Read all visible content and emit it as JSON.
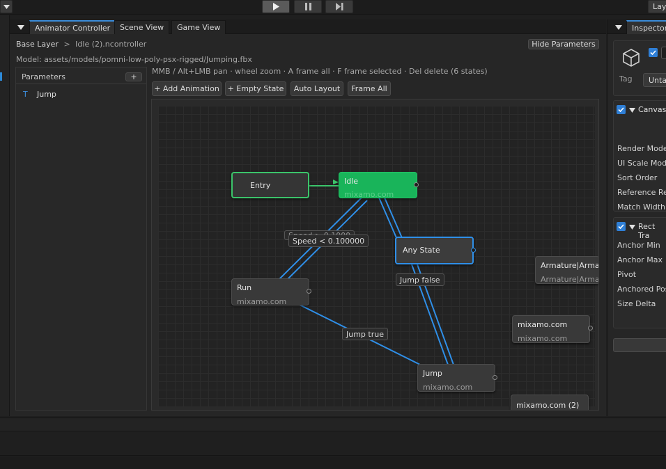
{
  "toolbar": {
    "play_icon": "play-icon",
    "pause_icon": "pause-icon",
    "step_icon": "step-icon",
    "layers_label": "Lay"
  },
  "animator_tabs": [
    {
      "label": "Animator Controller",
      "active": true
    },
    {
      "label": "Scene View",
      "active": false
    },
    {
      "label": "Game View",
      "active": false
    }
  ],
  "breadcrumb": {
    "layer": "Base Layer",
    "separator": ">",
    "controller": "Idle (2).ncontroller"
  },
  "hide_parameters_label": "Hide Parameters",
  "model_path": "Model: assets/models/pomni-low-poly-psx-rigged/Jumping.fbx",
  "help_text": "MMB / Alt+LMB pan · wheel zoom · A frame all · F frame selected · Del delete  (6 states)",
  "buttons": {
    "add_animation": "+ Add Animation",
    "empty_state": "+ Empty State",
    "auto_layout": "Auto Layout",
    "frame_all": "Frame All"
  },
  "parameters": {
    "title": "Parameters",
    "add_label": "+",
    "items": [
      {
        "type_glyph": "T",
        "name": "Jump"
      }
    ]
  },
  "graph": {
    "nodes": {
      "entry": {
        "name": "Entry"
      },
      "idle": {
        "name": "Idle",
        "sub": "mixamo.com"
      },
      "any_state": {
        "name": "Any State"
      },
      "run": {
        "name": "Run",
        "sub": "mixamo.com"
      },
      "jump": {
        "name": "Jump",
        "sub": "mixamo.com"
      },
      "armature": {
        "name": "Armature|Armat",
        "sub": "Armature|Armat"
      },
      "mixamo": {
        "name": "mixamo.com",
        "sub": "mixamo.com"
      },
      "mixamo2": {
        "name": "mixamo.com (2)"
      }
    },
    "edges": {
      "speed_hidden": "Speed > 0.1000",
      "speed": "Speed < 0.100000",
      "jump_false": "Jump false",
      "jump_true": "Jump true"
    },
    "colors": {
      "edge": "#2f8fe8",
      "entry_border": "#3bc46a",
      "idle_fill": "#19b45a",
      "selected_border": "#2f8fe8"
    }
  },
  "inspector": {
    "tab_label": "Inspector",
    "tag_label": "Tag",
    "tag_value": "Untag",
    "canvas": {
      "title": "Canvas",
      "rows": [
        "Render Mode",
        "UI Scale Mode",
        "Sort Order",
        "Reference Res",
        "Match Width C"
      ]
    },
    "rect": {
      "title": "Rect Tra",
      "rows": [
        "Anchor Min",
        "Anchor Max",
        "Pivot",
        "Anchored Posi",
        "Size Delta"
      ]
    }
  }
}
